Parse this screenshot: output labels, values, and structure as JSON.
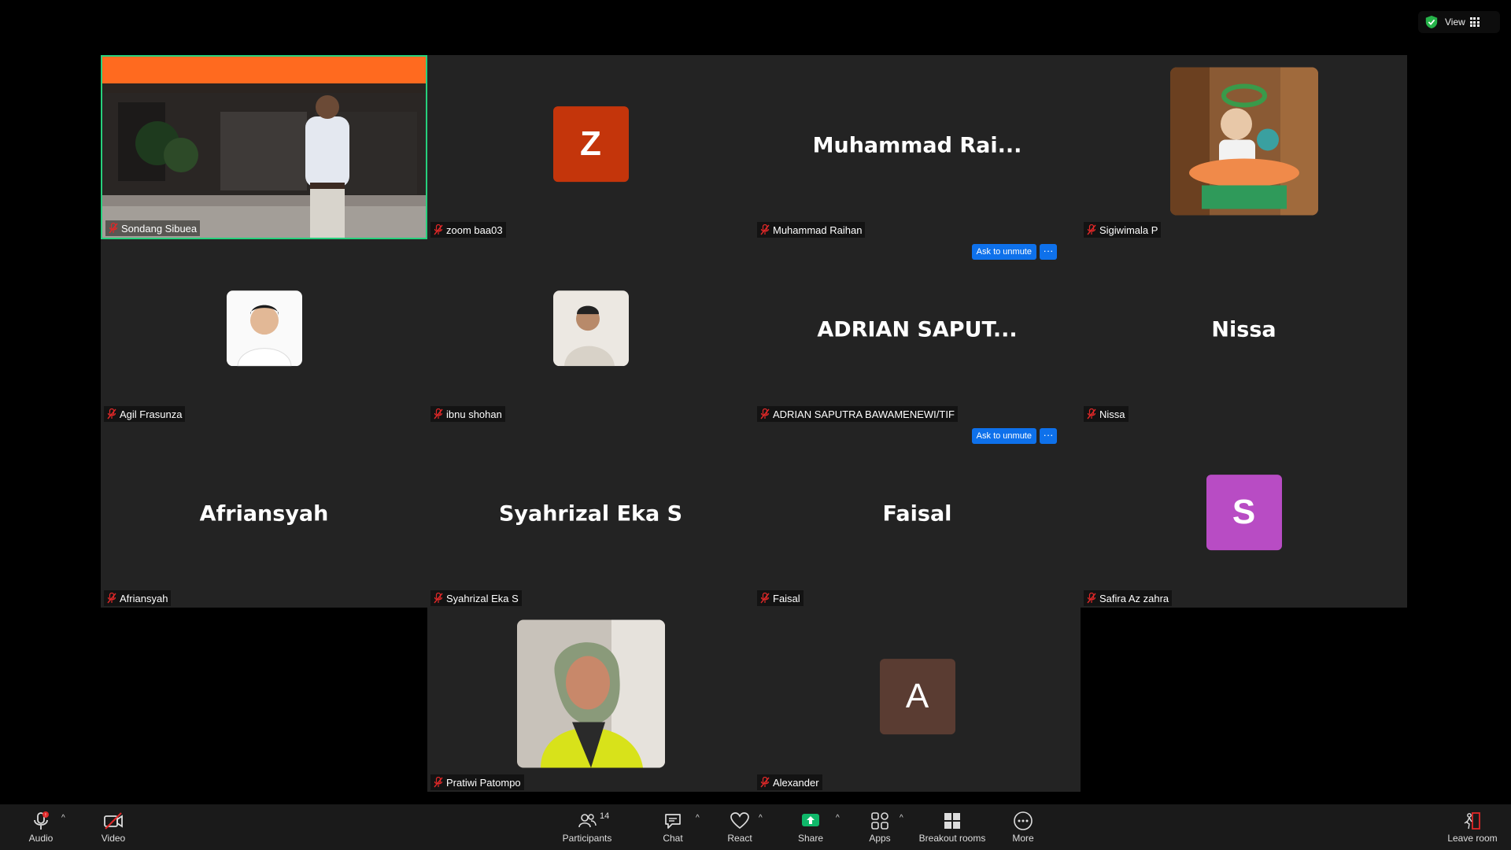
{
  "top": {
    "view_label": "View"
  },
  "tiles": [
    {
      "plate": "Sondang Sibuea"
    },
    {
      "plate": "zoom baa03",
      "avatar_letter": "Z",
      "avatar_color": "#c4350b"
    },
    {
      "plate": "Muhammad Raihan",
      "display": "Muhammad  Rai...",
      "ask": "Ask to unmute"
    },
    {
      "plate": "Sigiwimala P"
    },
    {
      "plate": "Agil Frasunza"
    },
    {
      "plate": "ibnu shohan"
    },
    {
      "plate": "ADRIAN SAPUTRA BAWAMENEWI/TIF",
      "display": "ADRIAN  SAPUT...",
      "ask": "Ask to unmute"
    },
    {
      "plate": "Nissa",
      "display": "Nissa"
    },
    {
      "plate": "Afriansyah",
      "display": "Afriansyah"
    },
    {
      "plate": "Syahrizal Eka S",
      "display": "Syahrizal Eka S"
    },
    {
      "plate": "Faisal",
      "display": "Faisal"
    },
    {
      "plate": "Safira Az zahra",
      "avatar_letter": "S",
      "avatar_color": "#b84cc4"
    },
    {
      "plate": "Pratiwi Patompo"
    },
    {
      "plate": "Alexander",
      "avatar_letter": "A",
      "avatar_color": "#5a3c32"
    }
  ],
  "toolbar": {
    "audio": "Audio",
    "video": "Video",
    "participants": "Participants",
    "participants_count": "14",
    "chat": "Chat",
    "react": "React",
    "share": "Share",
    "apps": "Apps",
    "breakout": "Breakout rooms",
    "more": "More",
    "leave": "Leave room",
    "caret": "^"
  },
  "colors": {
    "active_border": "#26d07c",
    "share_green": "#0fb86a",
    "alert_red": "#e02828",
    "button_blue": "#0e71eb"
  }
}
